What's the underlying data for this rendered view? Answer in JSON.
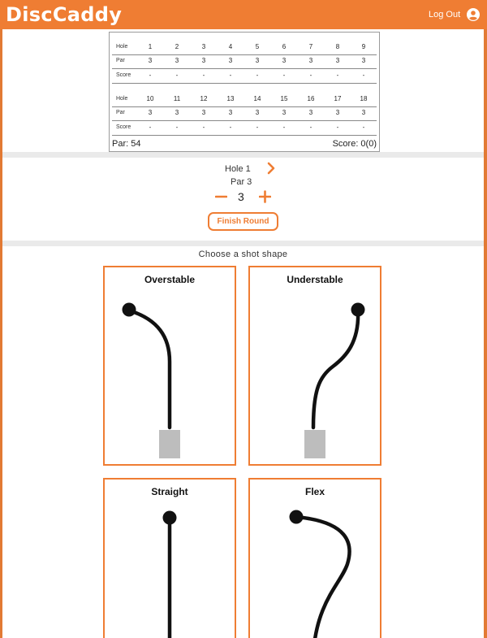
{
  "header": {
    "logo": "DiscCaddy",
    "logout_label": "Log Out",
    "user_icon": "account-circle-icon"
  },
  "scorecard": {
    "front": {
      "hole_label": "Hole",
      "par_label": "Par",
      "score_label": "Score",
      "holes": [
        "1",
        "2",
        "3",
        "4",
        "5",
        "6",
        "7",
        "8",
        "9"
      ],
      "pars": [
        "3",
        "3",
        "3",
        "3",
        "3",
        "3",
        "3",
        "3",
        "3"
      ],
      "scores": [
        "-",
        "-",
        "-",
        "-",
        "-",
        "-",
        "-",
        "-",
        "-"
      ]
    },
    "back": {
      "hole_label": "Hole",
      "par_label": "Par",
      "score_label": "Score",
      "holes": [
        "10",
        "11",
        "12",
        "13",
        "14",
        "15",
        "16",
        "17",
        "18"
      ],
      "pars": [
        "3",
        "3",
        "3",
        "3",
        "3",
        "3",
        "3",
        "3",
        "3"
      ],
      "scores": [
        "-",
        "-",
        "-",
        "-",
        "-",
        "-",
        "-",
        "-",
        "-"
      ]
    },
    "par_total": "Par: 54",
    "score_total": "Score: 0(0)"
  },
  "current_hole": {
    "hole_label": "Hole 1",
    "par_label": "Par 3",
    "score": "3",
    "next_icon": "chevron-right-icon",
    "minus_icon": "minus-icon",
    "plus_icon": "plus-icon",
    "finish_label": "Finish Round"
  },
  "shots": {
    "title": "Choose a shot shape",
    "items": [
      {
        "label": "Overstable"
      },
      {
        "label": "Understable"
      },
      {
        "label": "Straight"
      },
      {
        "label": "Flex"
      }
    ]
  },
  "colors": {
    "accent": "#ef7d33",
    "divider": "#eaeaea",
    "tee_pad": "#bdbdbd"
  }
}
